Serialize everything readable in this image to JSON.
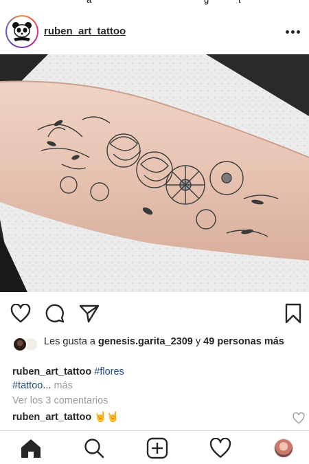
{
  "status_bar": {
    "fragments": [
      "a",
      "g",
      "t"
    ]
  },
  "post": {
    "username": "ruben_art_tattoo",
    "avatar_icon": "panda-logo-icon",
    "more_icon": "more-options-icon"
  },
  "actions": {
    "like_icon": "heart-icon",
    "comment_icon": "comment-bubble-icon",
    "share_icon": "send-arrow-icon",
    "save_icon": "bookmark-icon"
  },
  "likes": {
    "prefix": "Les gusta a ",
    "user": "genesis.garita_2309",
    "connector": " y ",
    "others": "49 personas más"
  },
  "caption": {
    "username": "ruben_art_tattoo",
    "hashtag1": "#flores",
    "hashtag2": "#tattoo",
    "ellipsis": "...",
    "more": " más"
  },
  "view_comments": "Ver los 3 comentarios",
  "comment": {
    "username": "ruben_art_tattoo",
    "text": "🤘🤘"
  },
  "bottom_nav": {
    "items": [
      "home-icon",
      "search-icon",
      "new-post-icon",
      "activity-heart-icon",
      "profile-avatar"
    ]
  },
  "colors": {
    "text": "#262626",
    "hashtag": "#1f4a7e",
    "muted": "#9a9a9a",
    "border": "#dbdbdb"
  }
}
